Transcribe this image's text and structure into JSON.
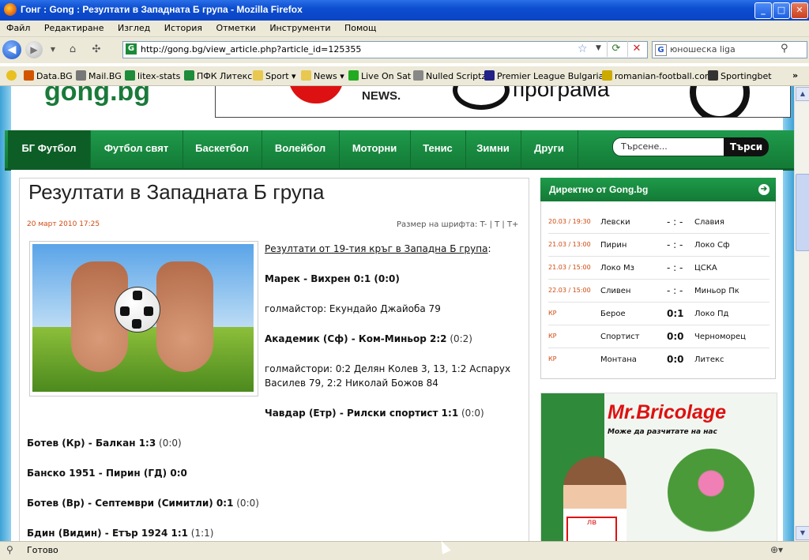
{
  "window": {
    "title": "Гонг : Gong : Резултати в Западната Б група - Mozilla Firefox",
    "buttons": {
      "minimize": "_",
      "maximize": "□",
      "close": "✕"
    }
  },
  "menu": [
    "Файл",
    "Редактиране",
    "Изглед",
    "История",
    "Отметки",
    "Инструменти",
    "Помощ"
  ],
  "nav": {
    "url": "http://gong.bg/view_article.php?article_id=125355",
    "search_value": "юношеска liga",
    "search_engine_icon": "G",
    "url_site_icon": "G"
  },
  "bookmarks": [
    {
      "label": "Data.BG",
      "color": "#d35400"
    },
    {
      "label": "Mail.BG",
      "color": "#777777"
    },
    {
      "label": "litex-stats",
      "color": "#1e8c3a"
    },
    {
      "label": "ПФК Литекс",
      "color": "#1e8c3a"
    },
    {
      "label": "Sport ▾",
      "color": "#e8c850"
    },
    {
      "label": "News ▾",
      "color": "#e8c850"
    },
    {
      "label": "Live On Sat",
      "color": "#22aa22"
    },
    {
      "label": "Nulled Scriptz",
      "color": "#888888"
    },
    {
      "label": "Premier League Bulgaria...",
      "color": "#222288"
    },
    {
      "label": "romanian-football.com",
      "color": "#ccaa00"
    },
    {
      "label": "Sportingbet",
      "color": "#333333"
    }
  ],
  "site": {
    "logo": "gong.bg",
    "banner": {
      "news": "NEWS.",
      "program": "програма"
    },
    "nav_items": [
      "БГ Футбол",
      "Футбол свят",
      "Баскетбол",
      "Волейбол",
      "Моторни",
      "Тенис",
      "Зимни",
      "Други"
    ],
    "search_placeholder": "Търсене...",
    "search_button": "Търси"
  },
  "article": {
    "title": "Резултати в Западната Б група",
    "date": "20 март 2010 17:25",
    "font_size_label": "Размер на шрифта: T- | T | T+",
    "intro_link": "Резултати от 19-тия кръг в Западна Б група",
    "intro_suffix": ":",
    "results": [
      {
        "match": "Марек - Вихрен 0:1 (0:0)",
        "score": ""
      },
      {
        "match": "голмайстор: Екундайо Джайоба 79",
        "score": ""
      },
      {
        "match": "Академик (Сф) - Ком-Миньор 2:2",
        "score": " (0:2)"
      },
      {
        "match": "голмайстори: 0:2 Делян Колев 3, 13, 1:2 Аспарух",
        "score": ""
      },
      {
        "match": "Василев 79, 2:2 Николай Божов 84",
        "score": ""
      },
      {
        "match": "Чавдар (Етр) - Рилски спортист 1:1",
        "score": " (0:0)"
      },
      {
        "match": "Ботев (Кр) - Балкан 1:3",
        "score": " (0:0)"
      },
      {
        "match": "Банско 1951 - Пирин (ГД) 0:0",
        "score": ""
      },
      {
        "match": "Ботев (Вр) - Септември (Симитли) 0:1",
        "score": " (0:0)"
      },
      {
        "match": "Бдин (Видин) - Етър 1924 1:1",
        "score": " (1:1)"
      }
    ]
  },
  "live": {
    "title": "Директно от Gong.bg",
    "arrow": "➔",
    "matches": [
      {
        "time": "20.03 / 19:30",
        "home": "Левски",
        "score": "- : -",
        "away": "Славия",
        "final": false
      },
      {
        "time": "21.03 / 13:00",
        "home": "Пирин",
        "score": "- : -",
        "away": "Локо Сф",
        "final": false
      },
      {
        "time": "21.03 / 15:00",
        "home": "Локо Мз",
        "score": "- : -",
        "away": "ЦСКА",
        "final": false
      },
      {
        "time": "22.03 / 15:00",
        "home": "Сливен",
        "score": "- : -",
        "away": "Миньор Пк",
        "final": false
      },
      {
        "time": "КР",
        "home": "Берое",
        "score": "0:1",
        "away": "Локо Пд",
        "final": true
      },
      {
        "time": "КР",
        "home": "Спортист",
        "score": "0:0",
        "away": "Черноморец",
        "final": true
      },
      {
        "time": "КР",
        "home": "Монтана",
        "score": "0:0",
        "away": "Литекс",
        "final": true
      }
    ]
  },
  "ad": {
    "brand": "Mr.Bricolage",
    "slogan": "Може да разчитате на нас",
    "price_unit": "лв"
  },
  "status": {
    "text": "Готово"
  }
}
